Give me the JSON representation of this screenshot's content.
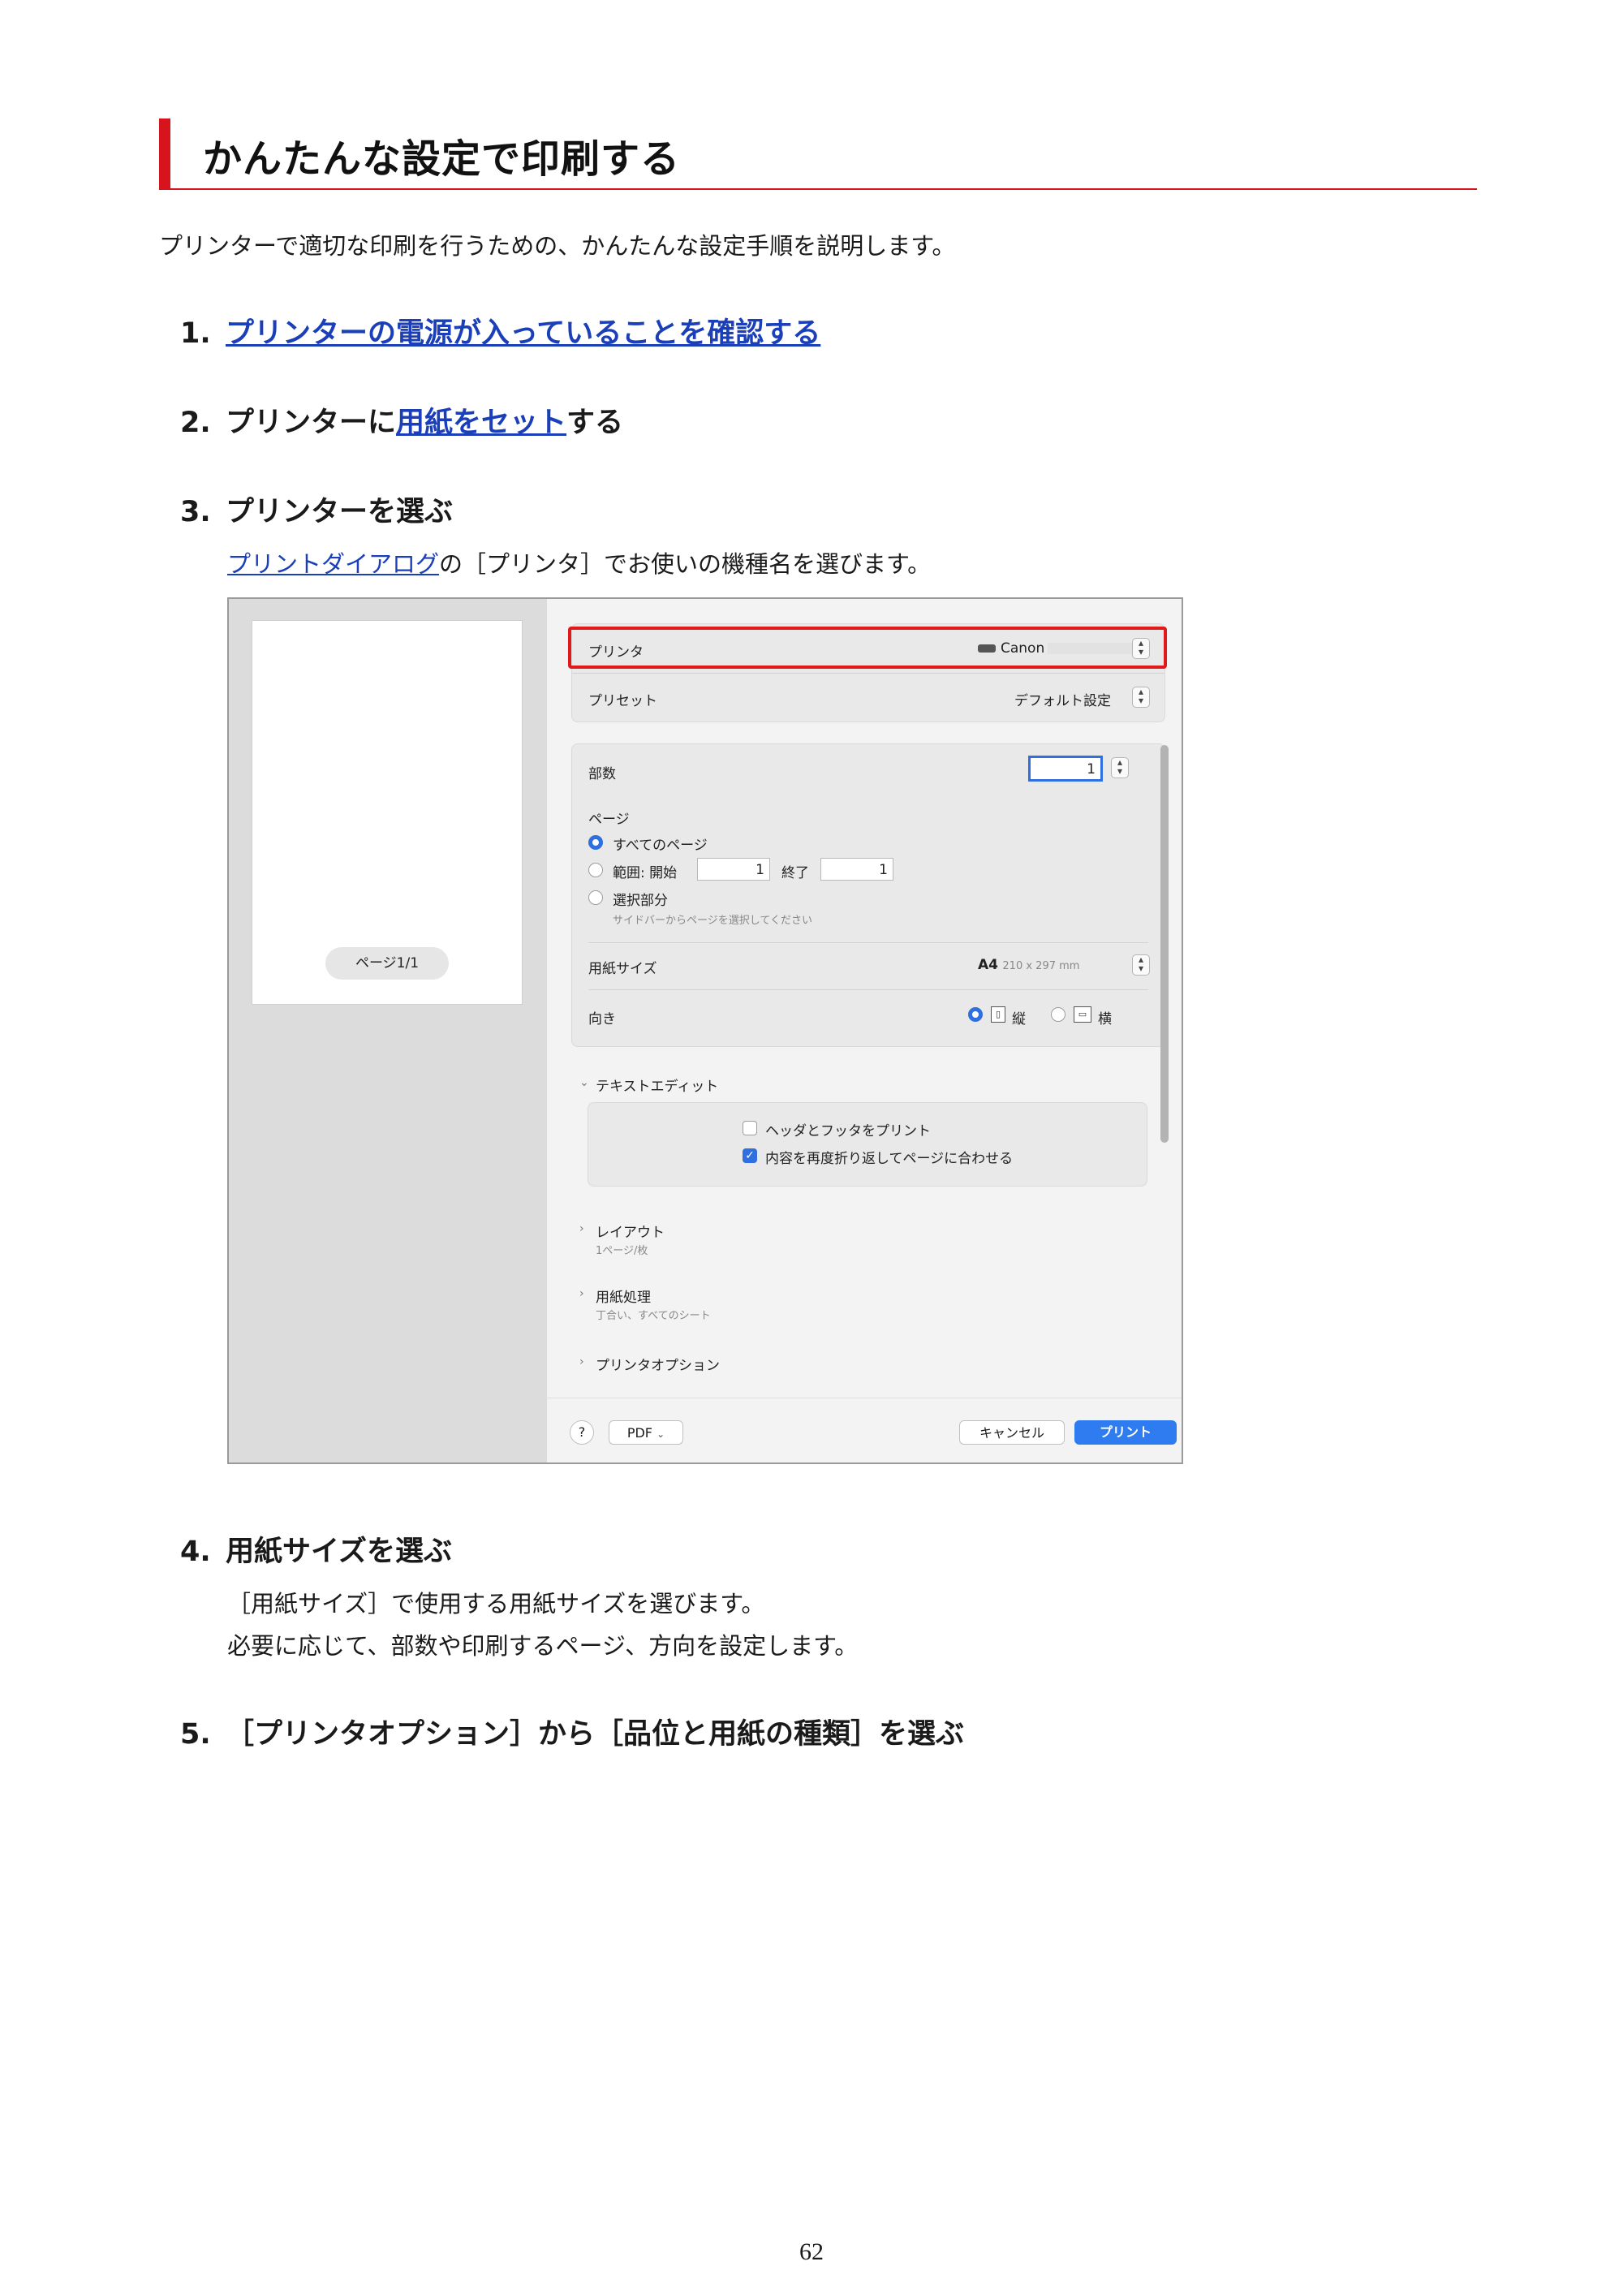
{
  "title": "かんたんな設定で印刷する",
  "intro": "プリンターで適切な印刷を行うための、かんたんな設定手順を説明します。",
  "steps": [
    {
      "num": "1.",
      "link": "プリンターの電源が入っていることを確認する"
    },
    {
      "num": "2.",
      "pre": "プリンターに",
      "link": "用紙をセット",
      "post": "する"
    },
    {
      "num": "3.",
      "text": "プリンターを選ぶ",
      "desc_link": "プリントダイアログ",
      "desc_post": "の［プリンタ］でお使いの機種名を選びます。"
    },
    {
      "num": "4.",
      "text": "用紙サイズを選ぶ",
      "desc1": "［用紙サイズ］で使用する用紙サイズを選びます。",
      "desc2": "必要に応じて、部数や印刷するページ、方向を設定します。"
    },
    {
      "num": "5.",
      "text": "［プリンタオプション］から［品位と用紙の種類］を選ぶ"
    }
  ],
  "dialog": {
    "preview_label": "ページ1/1",
    "printer_label": "プリンタ",
    "printer_value": "Canon",
    "preset_label": "プリセット",
    "preset_value": "デフォルト設定",
    "copies_label": "部数",
    "copies_value": "1",
    "pages_label": "ページ",
    "pages_all": "すべてのページ",
    "pages_range": "範囲: 開始",
    "range_from": "1",
    "range_end_label": "終了",
    "range_to": "1",
    "pages_selection": "選択部分",
    "pages_selection_hint": "サイドバーからページを選択してください",
    "paper_size_label": "用紙サイズ",
    "paper_size_value": "A4",
    "paper_size_dims": "210 x 297 mm",
    "orientation_label": "向き",
    "orientation_portrait": "縦",
    "orientation_landscape": "横",
    "textedit_section": "テキストエディット",
    "header_footer": "ヘッダとフッタをプリント",
    "rewrap": "内容を再度折り返してページに合わせる",
    "layout_section": "レイアウト",
    "layout_sub": "1ページ/枚",
    "paper_handling_section": "用紙処理",
    "paper_handling_sub": "丁合い、すべてのシート",
    "printer_options_section": "プリンタオプション",
    "help_label": "?",
    "pdf_label": "PDF",
    "cancel_label": "キャンセル",
    "print_label": "プリント"
  },
  "page_number": "62",
  "colors": {
    "accent_red": "#d7141e",
    "link_blue": "#1a3fb8",
    "mac_blue": "#2f7bf0"
  }
}
